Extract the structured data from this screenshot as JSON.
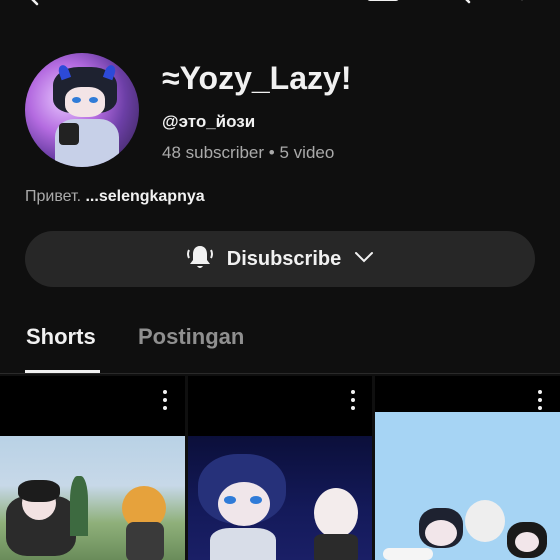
{
  "channel": {
    "name": "≈Yozy_Lazy!",
    "handle": "@это_йози",
    "subscribers": "48 subscriber",
    "separator": "•",
    "videos": "5 video",
    "description": "Привет.",
    "more_label": "...selengkapnya"
  },
  "subscribe_button": {
    "label": "Disubscribe",
    "icon": "bell-icon"
  },
  "tabs": [
    {
      "label": "Shorts",
      "active": true
    },
    {
      "label": "Postingan",
      "active": false
    }
  ],
  "colors": {
    "background": "#0f0f0f",
    "button_bg": "#272727",
    "text_primary": "#f1f1f1",
    "text_secondary": "#aaaaaa"
  }
}
